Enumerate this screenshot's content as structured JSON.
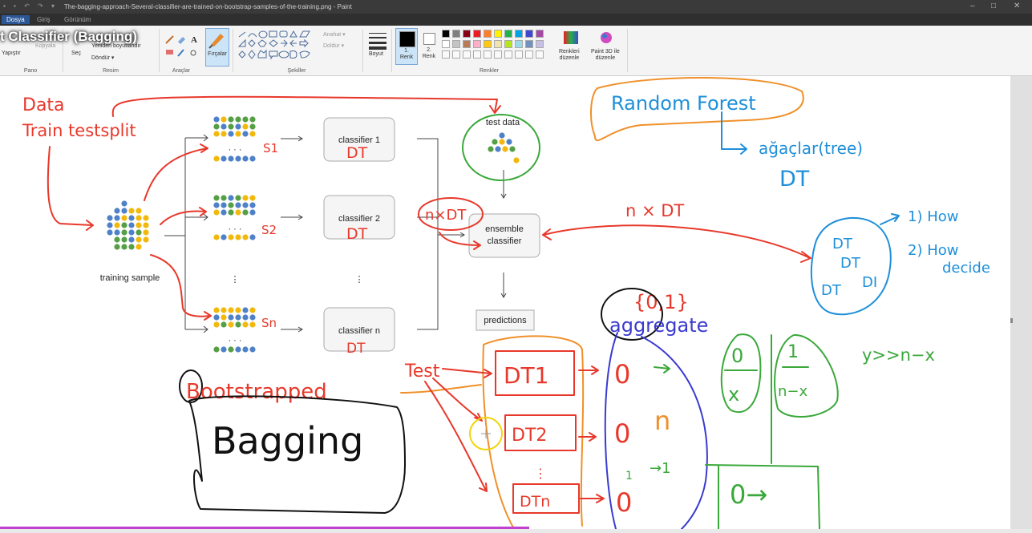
{
  "window": {
    "title": "The-bagging-approach-Several-classifier-are-trained-on-bootstrap-samples-of-the-training.png - Paint",
    "quick_access": "▪ ▪ ↶ ↷ ▾",
    "controls": {
      "minimize": "–",
      "maximize": "□",
      "close": "✕"
    }
  },
  "tabs": [
    {
      "label": "Dosya",
      "active": true
    },
    {
      "label": "Giriş",
      "active": false
    },
    {
      "label": "Görünüm",
      "active": false
    }
  ],
  "overlay_title": "t Classifier (Bagging)",
  "ribbon": {
    "pano": {
      "paste_label": "Yapıştır",
      "copy_label": "Kopyala",
      "group": "Pano"
    },
    "resim": {
      "select_label": "Seç",
      "resize_label": "Yeniden boyutlandır",
      "rotate_label": "Döndür ▾",
      "group": "Resim"
    },
    "araclar": {
      "group": "Araçlar"
    },
    "fircalar": {
      "label": "Fırçalar"
    },
    "sekiller": {
      "outline_label": "Anahat ▾",
      "fill_label": "Doldur ▾",
      "group": "Şekiller"
    },
    "boyut": {
      "label": "Boyut"
    },
    "renk1": {
      "label1": "1.",
      "label2": "Renk"
    },
    "renk2": {
      "label1": "2.",
      "label2": "Renk"
    },
    "renkler": {
      "edit_label1": "Renkleri",
      "edit_label2": "düzenle",
      "paint3d_label1": "Paint 3D ile",
      "paint3d_label2": "düzenle",
      "group": "Renkler"
    },
    "palette_row1": [
      "#000000",
      "#7f7f7f",
      "#880015",
      "#ed1c24",
      "#ff7f27",
      "#fff200",
      "#22b14c",
      "#00a2e8",
      "#3f48cc",
      "#a349a4"
    ],
    "palette_row2": [
      "#ffffff",
      "#c3c3c3",
      "#b97a57",
      "#ffaec9",
      "#ffc90e",
      "#efe4b0",
      "#b5e61d",
      "#99d9ea",
      "#7092be",
      "#c8bfe7"
    ]
  },
  "figure": {
    "training_sample": "training sample",
    "test_data": "test data",
    "classifier_1": "classifier 1",
    "classifier_2": "classifier 2",
    "classifier_n": "classifier n",
    "ensemble_1": "ensemble",
    "ensemble_2": "classifier",
    "predictions": "predictions",
    "dots": "· · ·",
    "vdots": "⋮"
  },
  "handwriting": {
    "data": "Data",
    "train_test_split": "Train testsplit",
    "s1": "S1",
    "s2": "S2",
    "sn": "Sn",
    "dt1": "DT",
    "dt2": "DT",
    "dtn": "DT",
    "nxdt_left": "n×DT",
    "nxdt_mid": "n × DT",
    "random_forest": "Random Forest",
    "agaclar": "ağaçlar(tree)",
    "dt_big": "DT",
    "how_1": "1) How",
    "how_2": "2) How",
    "decide": "decide",
    "dt_circle_1": "DT",
    "dt_circle_2": "DT",
    "dt_circle_3": "DT",
    "dt_circle_4": "DI",
    "set01": "{0,1}",
    "aggregate": "aggregate",
    "y_gg": "y>>n−x",
    "test": "Test",
    "box_dt1": "DT1",
    "box_dt2": "DT2",
    "box_dtn": "DTn",
    "pred_0a": "0",
    "pred_0b": "0",
    "pred_0c": "0",
    "pred_n": "n",
    "pred_y1": "1",
    "pred_arrow1": "→1",
    "frac_top": "0",
    "frac_bot": "x",
    "frac2_top": "1",
    "frac2_bot": "n−x",
    "box_final": "0→",
    "bootstrapped": "Bootstrapped",
    "bagging": "Bagging"
  },
  "colors": {
    "red": "#e8382b",
    "blue": "#1e8fd8",
    "green": "#3aa83a",
    "orange": "#f0902a",
    "navy": "#3a3ad0",
    "dot_blue": "#4f81c8",
    "dot_yellow": "#f2b90c",
    "dot_green": "#55a045"
  }
}
